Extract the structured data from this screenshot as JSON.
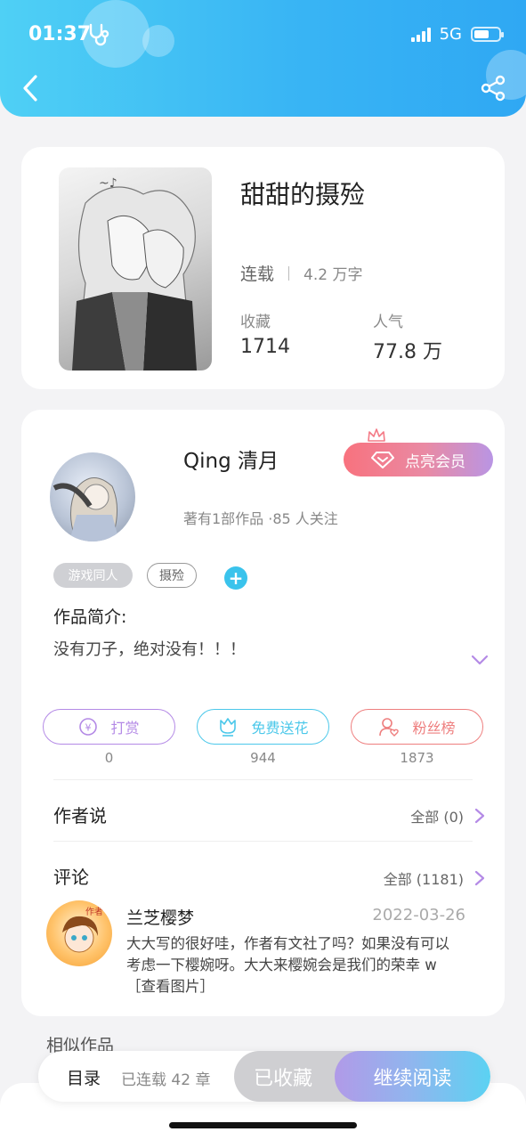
{
  "status_bar": {
    "time": "01:37",
    "network": "5G"
  },
  "book": {
    "title": "甜甜的摄殓",
    "status": "连载",
    "word_count": "4.2 万字",
    "stats": [
      {
        "label": "收藏",
        "value": "1714"
      },
      {
        "label": "人气",
        "value": "77.8 万"
      }
    ]
  },
  "author": {
    "name": "Qing 清月",
    "meta": "著有1部作品 ·85 人关注",
    "vip_label": "点亮会员",
    "tags": [
      "游戏同人",
      "摄殓"
    ],
    "intro_label": "作品简介:",
    "intro_text": "没有刀子，绝对没有！！！"
  },
  "actions": [
    {
      "label": "打赏",
      "count": "0",
      "color": "#b48ae6"
    },
    {
      "label": "免费送花",
      "count": "944",
      "color": "#4cc8ea"
    },
    {
      "label": "粉丝榜",
      "count": "1873",
      "color": "#ee7e7e"
    }
  ],
  "author_says": {
    "title": "作者说",
    "more": "全部 (0)"
  },
  "comments": {
    "title": "评论",
    "more": "全部 (1181)",
    "items": [
      {
        "user": "兰芝樱梦",
        "badge": "作者",
        "date": "2022-03-26",
        "text": "大大写的很好哇，作者有文社了吗？如果没有可以考虑一下樱婉呀。大大来樱婉会是我们的荣幸 w［查看图片］"
      }
    ]
  },
  "similar_title": "相似作品",
  "bottom_bar": {
    "toc_label": "目录",
    "toc_count": "已连载 42 章",
    "collected_label": "已收藏",
    "read_label": "继续阅读"
  }
}
